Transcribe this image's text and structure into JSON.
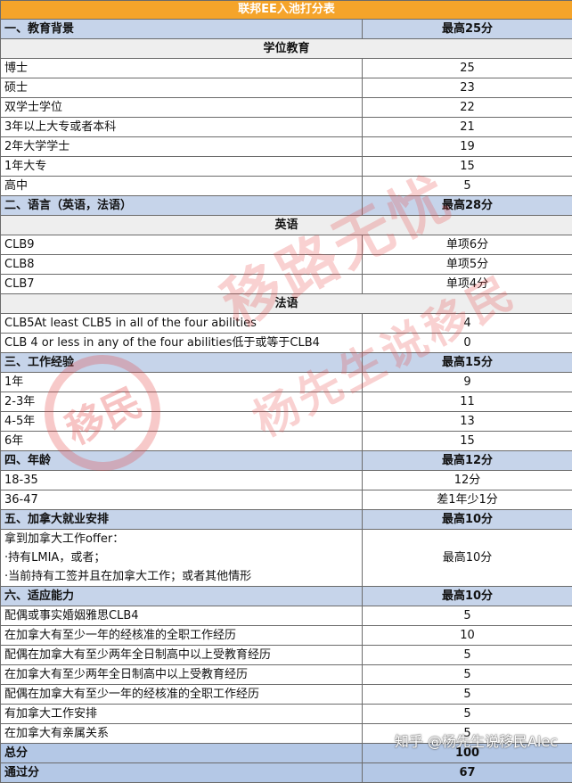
{
  "title": "联邦EE入池打分表",
  "education": {
    "header": "一、教育背景",
    "max": "最高25分",
    "sub": "学位教育",
    "rows": [
      {
        "label": "博士",
        "value": "25"
      },
      {
        "label": "硕士",
        "value": "23"
      },
      {
        "label": "双学士学位",
        "value": "22"
      },
      {
        "label": "3年以上大专或者本科",
        "value": "21"
      },
      {
        "label": "2年大学学士",
        "value": "19"
      },
      {
        "label": "1年大专",
        "value": "15"
      },
      {
        "label": "高中",
        "value": "5"
      }
    ]
  },
  "language": {
    "header": "二、语言（英语，法语）",
    "max": "最高28分",
    "english_sub": "英语",
    "english_rows": [
      {
        "label": "CLB9",
        "value": "单项6分"
      },
      {
        "label": "CLB8",
        "value": "单项5分"
      },
      {
        "label": "CLB7",
        "value": "单项4分"
      }
    ],
    "french_sub": "法语",
    "french_rows": [
      {
        "label": "CLB5At least CLB5 in all of the four abilities",
        "value": "4"
      },
      {
        "label": "CLB 4 or less in any of the four abilities低于或等于CLB4",
        "value": "0"
      }
    ]
  },
  "work": {
    "header": "三、工作经验",
    "max": "最高15分",
    "rows": [
      {
        "label": "1年",
        "value": "9"
      },
      {
        "label": "2-3年",
        "value": "11"
      },
      {
        "label": "4-5年",
        "value": "13"
      },
      {
        "label": "6年",
        "value": "15"
      }
    ]
  },
  "age": {
    "header": "四、年龄",
    "max": "最高12分",
    "rows": [
      {
        "label": "18-35",
        "value": "12分"
      },
      {
        "label": "36-47",
        "value": "差1年少1分"
      }
    ]
  },
  "employment": {
    "header": "五、加拿大就业安排",
    "max": "最高10分",
    "lines": [
      "拿到加拿大工作offer：",
      "·持有LMIA，或者；",
      "·当前持有工签并且在加拿大工作；或者其他情形"
    ],
    "value": "最高10分"
  },
  "adapt": {
    "header": "六、适应能力",
    "max": "最高10分",
    "rows": [
      {
        "label": "配偶或事实婚姻雅思CLB4",
        "value": "5"
      },
      {
        "label": "在加拿大有至少一年的经核准的全职工作经历",
        "value": "10"
      },
      {
        "label": "配偶在加拿大有至少两年全日制高中以上受教育经历",
        "value": "5"
      },
      {
        "label": "在加拿大有至少两年全日制高中以上受教育经历",
        "value": "5"
      },
      {
        "label": "配偶在加拿大有至少一年的经核准的全职工作经历",
        "value": "5"
      },
      {
        "label": "有加拿大工作安排",
        "value": "5"
      },
      {
        "label": "在加拿大有亲属关系",
        "value": "5"
      }
    ]
  },
  "total": {
    "label": "总分",
    "value": "100"
  },
  "pass": {
    "label": "通过分",
    "value": "67"
  },
  "watermarks": {
    "seal": "移民",
    "line1": "移路无忧",
    "line2": "杨先生说移民",
    "zhihu": "知乎 @杨先生说移民Alec"
  },
  "colors": {
    "title_bg": "#f5a42a",
    "section_bg": "#c6d4ea",
    "sub_bg": "#eeeeee",
    "footer_bg": "#b4c8e6",
    "watermark": "#e43c3c"
  }
}
